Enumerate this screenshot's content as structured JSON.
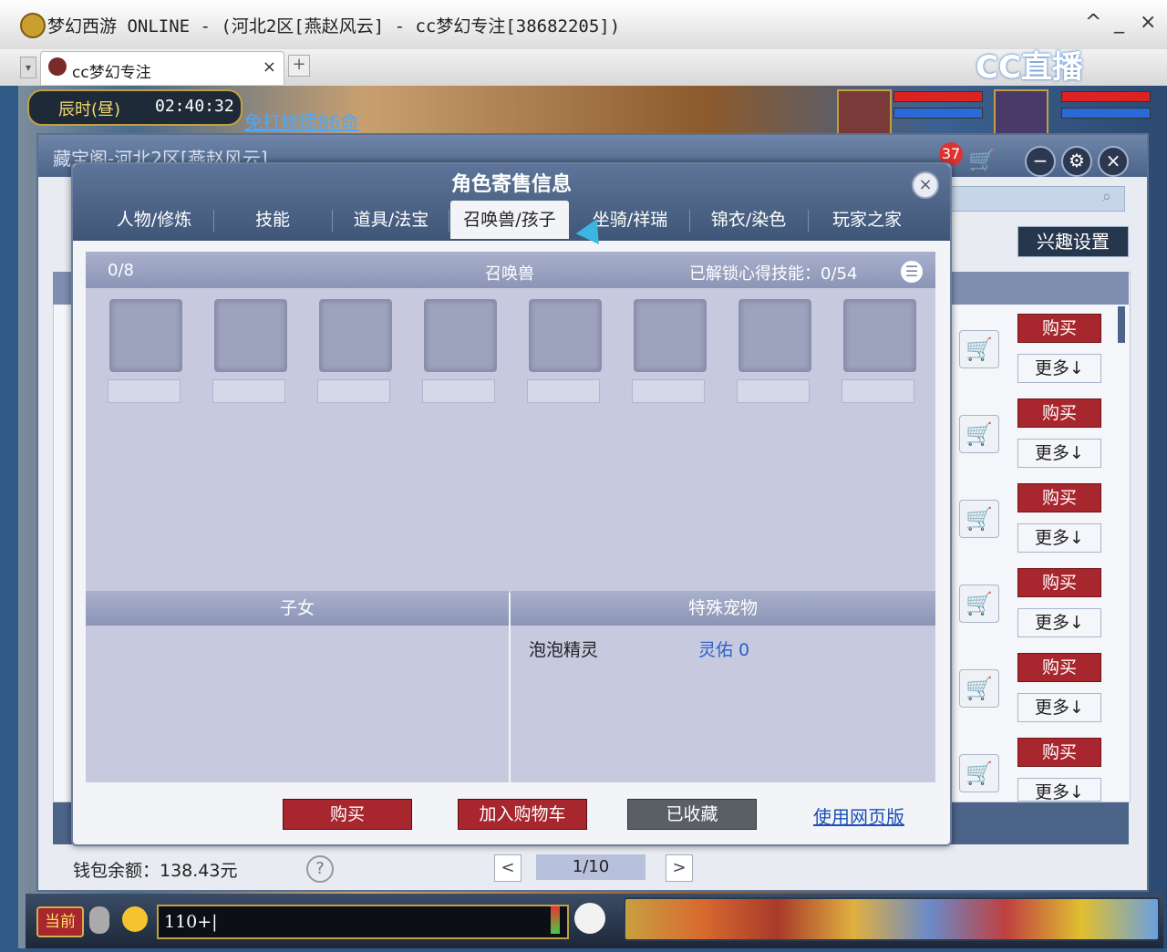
{
  "window": {
    "title": "梦幻西游 ONLINE - (河北2区[燕赵风云] - cc梦幻专注[38682205])",
    "controls": [
      "^",
      "_",
      "×"
    ]
  },
  "browser": {
    "tab_label": "cc梦幻专注",
    "tab_close": "×",
    "new_tab": "+",
    "brand": "CC直播"
  },
  "game_hud": {
    "time_label": "辰时(昼)",
    "time_value": "02:40:32",
    "repair_link": "免打修理86命"
  },
  "shop": {
    "title": "藏宝阁-河北2区[燕赵风云]",
    "cart_count": "37",
    "interest_button": "兴趣设置",
    "buy_label": "购买",
    "more_label": "更多↓",
    "wallet": "钱包余额：138.43元",
    "help": "?",
    "page": "1/10",
    "prev": "<",
    "next": ">"
  },
  "dialog": {
    "title": "角色寄售信息",
    "close": "×",
    "tabs": [
      "人物/修炼",
      "技能",
      "道具/法宝",
      "召唤兽/孩子",
      "坐骑/祥瑞",
      "锦衣/染色",
      "玩家之家"
    ],
    "active_tab": 3,
    "summon": {
      "count": "0/8",
      "heading": "召唤兽",
      "unlocked_skills": "已解锁心得技能：0/54"
    },
    "children_heading": "子女",
    "special_heading": "特殊宠物",
    "special_pet": {
      "name": "泡泡精灵",
      "value": "灵佑 0"
    },
    "buttons": {
      "buy": "购买",
      "add_cart": "加入购物车",
      "favorited": "已收藏",
      "web_version": "使用网页版"
    }
  },
  "chat": {
    "channel": "当前",
    "input_value": "110+|"
  },
  "colors": {
    "accent_red": "#a8262d",
    "header_blue": "#4c6488",
    "link_blue": "#2a62c8"
  }
}
